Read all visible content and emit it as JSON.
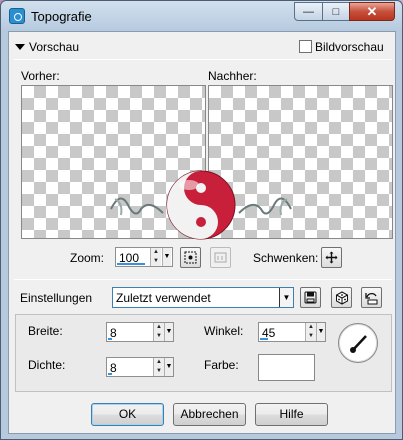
{
  "window": {
    "title": "Topografie",
    "minimize_symbol": "—",
    "maximize_symbol": "□",
    "close_symbol": "✕"
  },
  "preview": {
    "section_label": "Vorschau",
    "proof_label": "Bildvorschau",
    "proof_checked": false,
    "before_label": "Vorher:",
    "after_label": "Nachher:"
  },
  "zoom": {
    "label": "Zoom:",
    "value": "100",
    "pan_label": "Schwenken:"
  },
  "settings": {
    "label": "Einstellungen",
    "preset": "Zuletzt verwendet"
  },
  "params": {
    "width_label": "Breite:",
    "width_value": "8",
    "density_label": "Dichte:",
    "density_value": "8",
    "angle_label": "Winkel:",
    "angle_value": "45",
    "color_label": "Farbe:",
    "color_value": "#ffffff"
  },
  "buttons": {
    "ok": "OK",
    "cancel": "Abbrechen",
    "help": "Hilfe"
  },
  "icons": [
    "app-icon",
    "fit-icon",
    "actual-size-icon",
    "pan-icon",
    "save-preset-icon",
    "randomize-icon",
    "reset-icon",
    "angle-dial-icon"
  ]
}
